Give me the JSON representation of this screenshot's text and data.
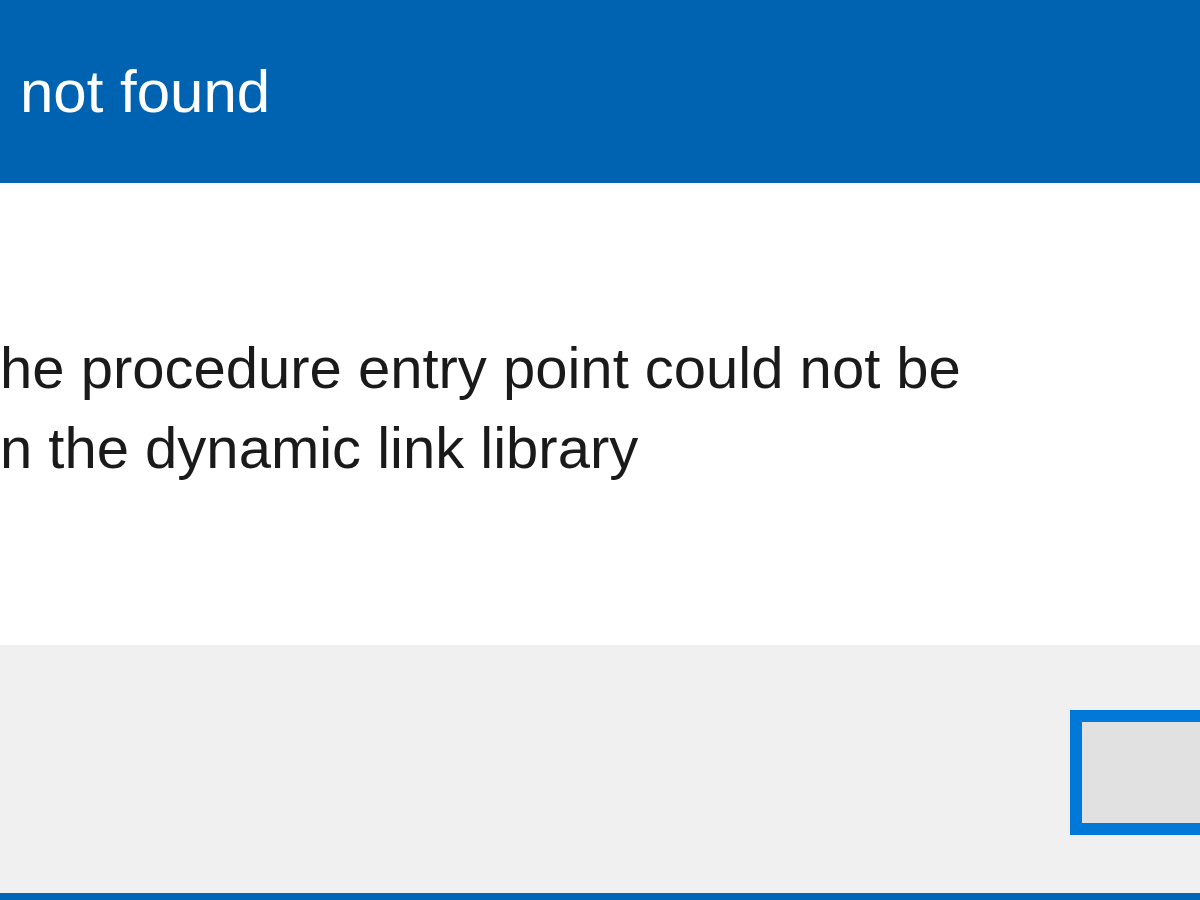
{
  "window": {
    "title": "not found"
  },
  "message": [
    "he procedure entry point could not be",
    "n the dynamic link library"
  ],
  "button": {
    "focused": true
  }
}
